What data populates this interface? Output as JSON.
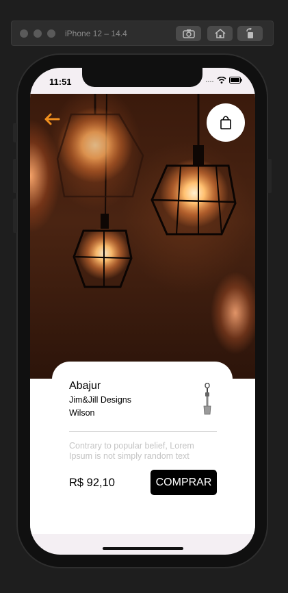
{
  "simulator": {
    "title": "iPhone 12 – 14.4"
  },
  "status_bar": {
    "time": "11:51"
  },
  "product": {
    "name": "Abajur",
    "brand": "Jim&Jill Designs",
    "author": "Wilson",
    "description": "Contrary to popular belief, Lorem Ipsum is not simply random text",
    "price": "R$ 92,10",
    "buy_label": "COMPRAR"
  },
  "colors": {
    "accent": "#f0901e",
    "buy_button": "#000000",
    "description_text": "#c4c4c4"
  },
  "icons": {
    "back": "arrow-left-icon",
    "bag": "shopping-bag-icon",
    "screenshot": "camera-icon",
    "home": "home-icon",
    "rotate": "rotate-icon"
  }
}
